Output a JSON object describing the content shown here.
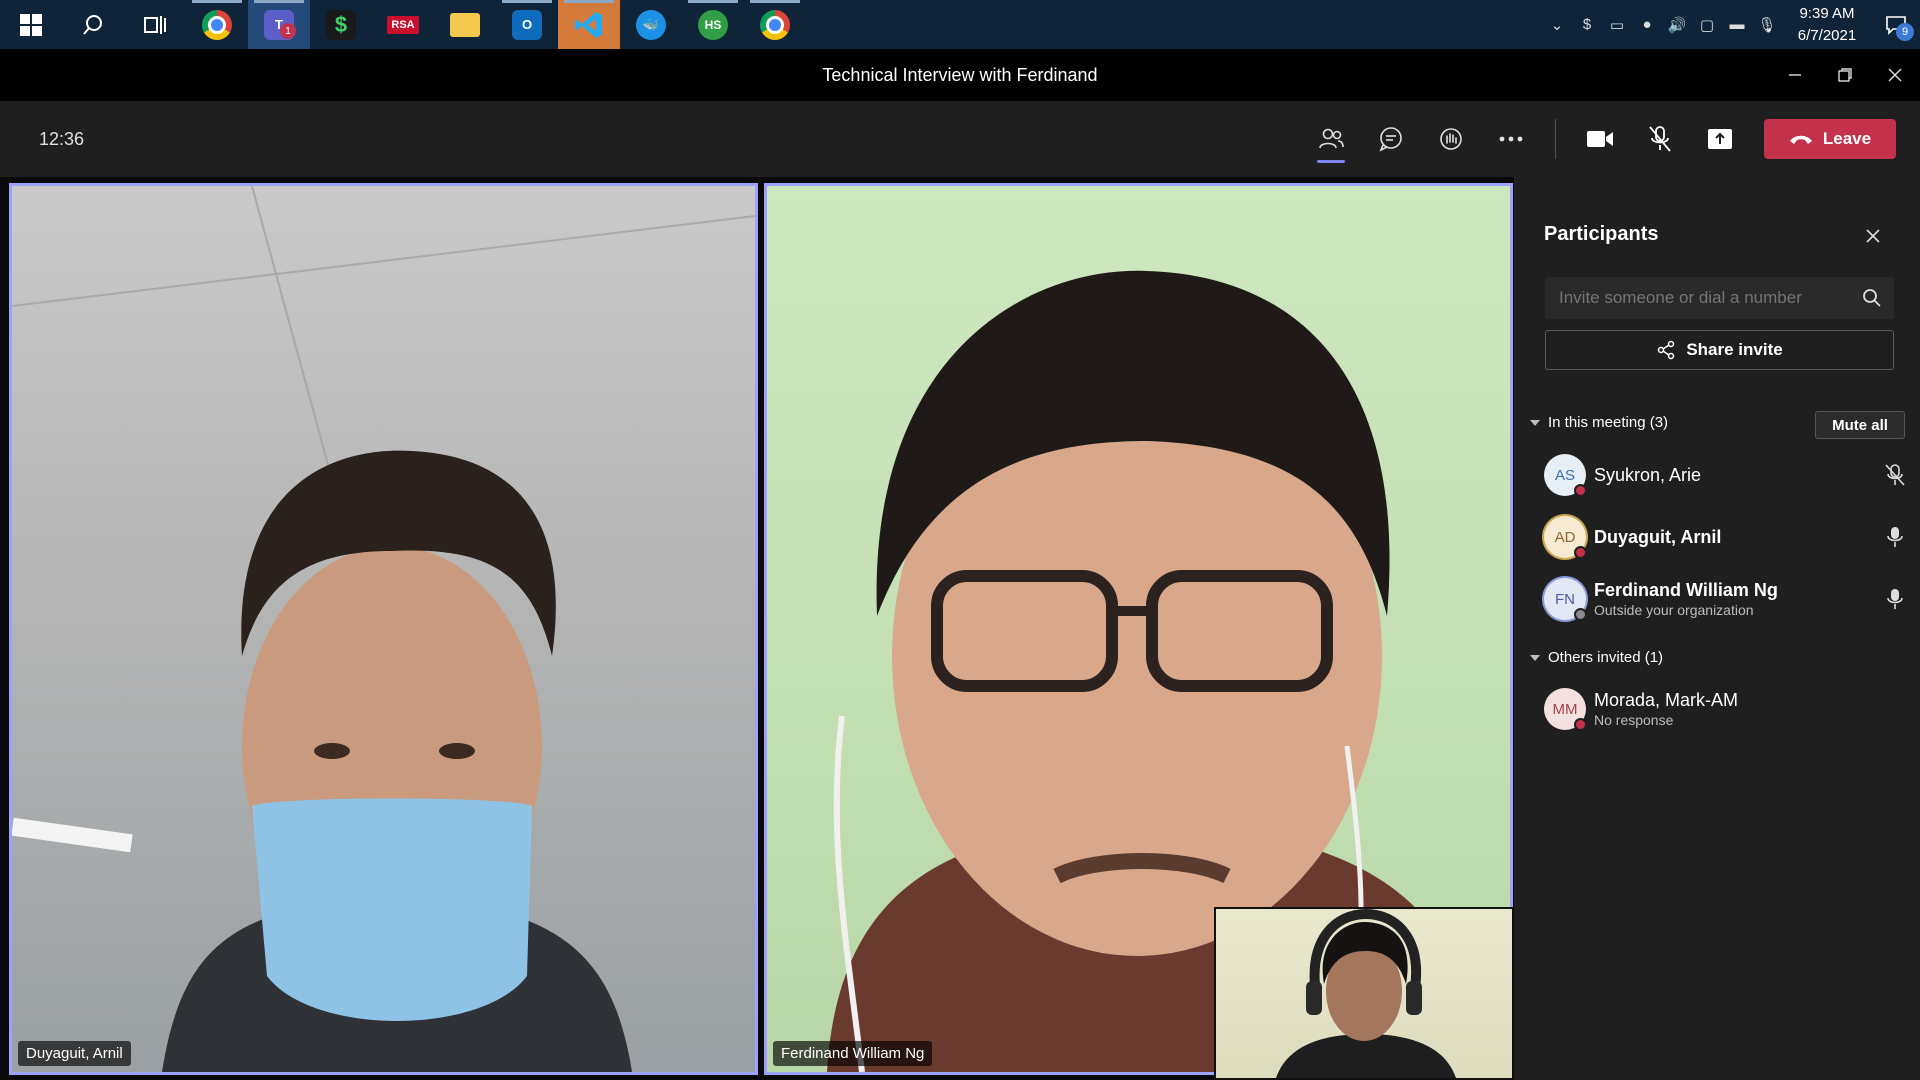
{
  "taskbar": {
    "apps": [
      {
        "name": "start-button",
        "icon": "windows-logo-icon"
      },
      {
        "name": "search-button",
        "icon": "search-icon"
      },
      {
        "name": "task-view-button",
        "icon": "task-view-icon"
      },
      {
        "name": "chrome-app",
        "icon": "chrome-icon"
      },
      {
        "name": "teams-app",
        "icon": "teams-icon",
        "badge": "1"
      },
      {
        "name": "dollar-app",
        "icon": "dollar-icon"
      },
      {
        "name": "rsa-app",
        "icon": "rsa-icon",
        "label": "RSA"
      },
      {
        "name": "file-explorer-app",
        "icon": "folder-icon"
      },
      {
        "name": "outlook-app",
        "icon": "outlook-icon"
      },
      {
        "name": "vscode-app",
        "icon": "vscode-icon"
      },
      {
        "name": "docker-app",
        "icon": "docker-icon"
      },
      {
        "name": "hs-app",
        "icon": "hs-icon",
        "label": "HS"
      },
      {
        "name": "chrome-app-2",
        "icon": "chrome-icon"
      }
    ],
    "clock_time": "9:39 AM",
    "clock_date": "6/7/2021",
    "notification_count": "9"
  },
  "window": {
    "title": "Technical Interview with Ferdinand"
  },
  "meeting": {
    "elapsed": "12:36",
    "leave_label": "Leave"
  },
  "videos": [
    {
      "name": "Duyaguit, Arnil"
    },
    {
      "name": "Ferdinand William Ng"
    }
  ],
  "panel": {
    "title": "Participants",
    "invite_placeholder": "Invite someone or dial a number",
    "share_label": "Share invite",
    "in_meeting_label": "In this meeting (3)",
    "mute_all_label": "Mute all",
    "others_label": "Others invited (1)",
    "participants": [
      {
        "initials": "AS",
        "name": "Syukron, Arie",
        "sub": "",
        "muted": true,
        "status_color": "#c4314b",
        "avatar_bg": "#e6eef6",
        "avatar_fg": "#3d6fa8"
      },
      {
        "initials": "AD",
        "name": "Duyaguit, Arnil",
        "sub": "",
        "muted": false,
        "status_color": "#c4314b",
        "avatar_bg": "#f6ead2",
        "avatar_fg": "#8a6a2f"
      },
      {
        "initials": "FN",
        "name": "Ferdinand William Ng",
        "sub": "Outside your organization",
        "muted": false,
        "status_color": "#8a8a8a",
        "avatar_bg": "#e3e8f5",
        "avatar_fg": "#4a5c9a"
      }
    ],
    "invited": [
      {
        "initials": "MM",
        "name": "Morada, Mark-AM",
        "sub": "No response",
        "status_color": "#c4314b",
        "avatar_bg": "#f5e0e0",
        "avatar_fg": "#a04848"
      }
    ]
  },
  "colors": {
    "accent": "#7f85f5",
    "leave": "#c4314b",
    "video_border": "#9ea2ff"
  }
}
